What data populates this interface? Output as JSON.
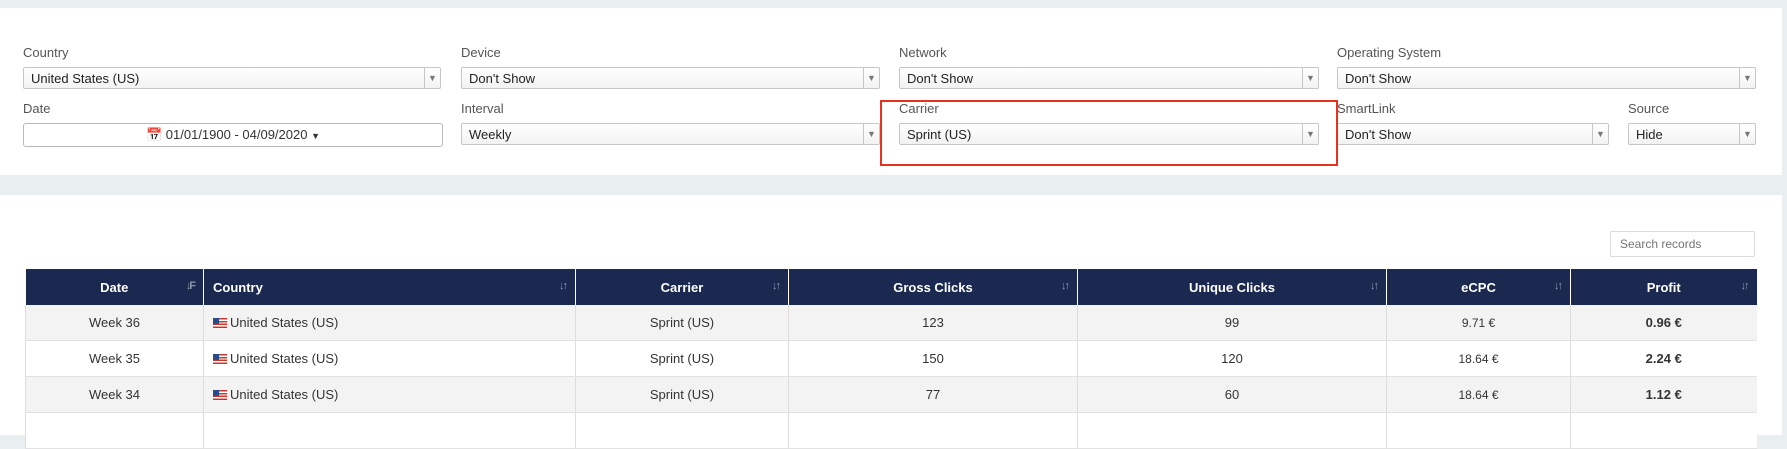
{
  "filters": {
    "country": {
      "label": "Country",
      "value": "United States (US)"
    },
    "device": {
      "label": "Device",
      "value": "Don't Show"
    },
    "network": {
      "label": "Network",
      "value": "Don't Show"
    },
    "os": {
      "label": "Operating System",
      "value": "Don't Show"
    },
    "date": {
      "label": "Date",
      "value": "01/01/1900 - 04/09/2020"
    },
    "interval": {
      "label": "Interval",
      "value": "Weekly"
    },
    "carrier": {
      "label": "Carrier",
      "value": "Sprint (US)"
    },
    "smartlink": {
      "label": "SmartLink",
      "value": "Don't Show"
    },
    "source": {
      "label": "Source",
      "value": "Hide"
    }
  },
  "search": {
    "placeholder": "Search records"
  },
  "table": {
    "headers": [
      "Date",
      "Country",
      "Carrier",
      "Gross Clicks",
      "Unique Clicks",
      "eCPC",
      "Profit"
    ],
    "rows": [
      [
        "Week 36",
        "United States (US)",
        "Sprint (US)",
        "123",
        "99",
        "9.71 €",
        "0.96 €"
      ],
      [
        "Week 35",
        "United States (US)",
        "Sprint (US)",
        "150",
        "120",
        "18.64 €",
        "2.24 €"
      ],
      [
        "Week 34",
        "United States (US)",
        "Sprint (US)",
        "77",
        "60",
        "18.64 €",
        "1.12 €"
      ]
    ]
  },
  "colors": {
    "header_bg": "#1b2950",
    "highlight": "#e8321e"
  },
  "icons": {
    "calendar": "calendar-icon",
    "sort": "sort-icon",
    "flag": "us-flag-icon"
  }
}
